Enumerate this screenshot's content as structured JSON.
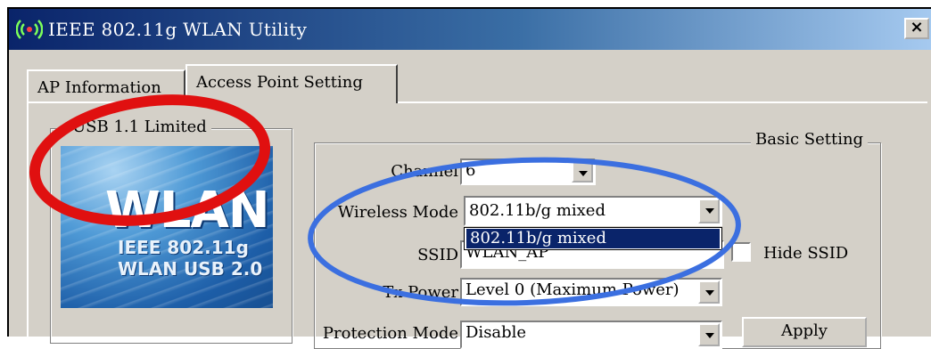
{
  "window": {
    "title": "IEEE 802.11g WLAN Utility",
    "close_glyph": "×"
  },
  "tabs": [
    {
      "label": "AP Information",
      "active": false
    },
    {
      "label": "Access Point Setting",
      "active": true
    }
  ],
  "left_group": {
    "label": "USB 1.1 Limited",
    "logo": {
      "big_text": "WLAN",
      "line1": "IEEE 802.11g",
      "line2": "WLAN USB 2.0"
    }
  },
  "basic_setting": {
    "label": "Basic Setting",
    "channel": {
      "label": "Channel",
      "value": "6"
    },
    "wireless_mode": {
      "label": "Wireless Mode",
      "value": "802.11b/g mixed",
      "open_option": "802.11b/g mixed"
    },
    "ssid": {
      "label": "SSID",
      "value": "WLAN_AP",
      "hide_label": "Hide SSID",
      "hide_checked": false
    },
    "tx_power": {
      "label": "Tx Power",
      "value": "Level 0 (Maximum Power)"
    },
    "protection_mode": {
      "label": "Protection Mode",
      "value": "Disable"
    },
    "apply_label": "Apply"
  },
  "annotations": {
    "red_ellipse_color": "#e01010",
    "blue_ellipse_color": "#3b6fe0"
  },
  "colors": {
    "titlebar_start": "#0a246a",
    "titlebar_end": "#a6caf0",
    "dialog_face": "#d4d0c8",
    "selection": "#0a246a"
  }
}
